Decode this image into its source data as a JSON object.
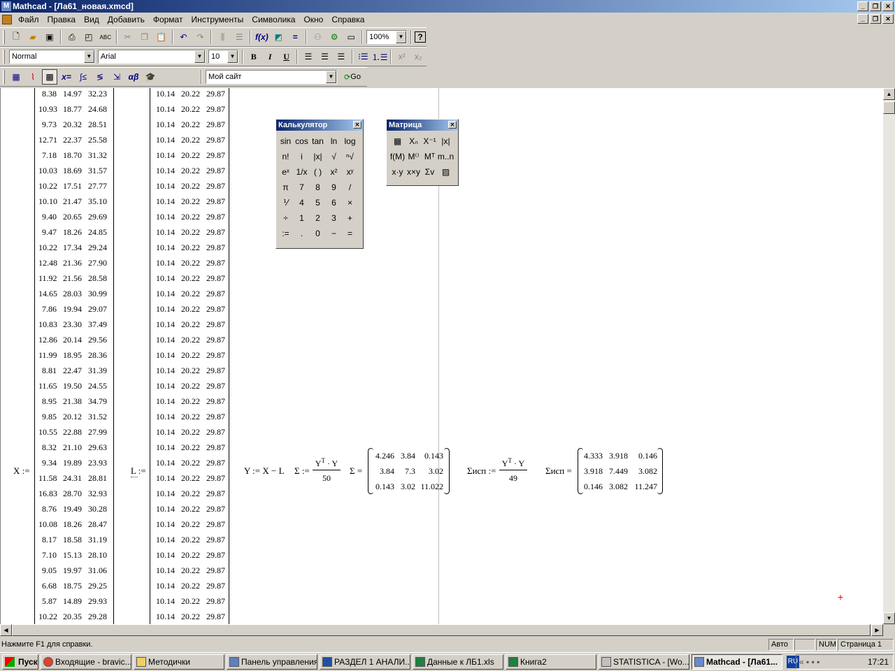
{
  "window": {
    "title": "Mathcad - [Ла61_новая.xmcd]"
  },
  "menu": [
    "Файл",
    "Правка",
    "Вид",
    "Добавить",
    "Формат",
    "Инструменты",
    "Символика",
    "Окно",
    "Справка"
  ],
  "toolbar": {
    "zoom": "100%"
  },
  "format": {
    "style": "Normal",
    "font": "Arial",
    "size": "10",
    "bold": "B",
    "italic": "I",
    "underline": "U"
  },
  "math_toolbar": {
    "address": "Мой сайт",
    "go": "Go"
  },
  "worksheet": {
    "x_label": "X :=",
    "l_label": "L :=",
    "X": [
      [
        "8.38",
        "14.97",
        "32.23"
      ],
      [
        "10.93",
        "18.77",
        "24.68"
      ],
      [
        "9.73",
        "20.32",
        "28.51"
      ],
      [
        "12.71",
        "22.37",
        "25.58"
      ],
      [
        "7.18",
        "18.70",
        "31.32"
      ],
      [
        "10.03",
        "18.69",
        "31.57"
      ],
      [
        "10.22",
        "17.51",
        "27.77"
      ],
      [
        "10.10",
        "21.47",
        "35.10"
      ],
      [
        "9.40",
        "20.65",
        "29.69"
      ],
      [
        "9.47",
        "18.26",
        "24.85"
      ],
      [
        "10.22",
        "17.34",
        "29.24"
      ],
      [
        "12.48",
        "21.36",
        "27.90"
      ],
      [
        "11.92",
        "21.56",
        "28.58"
      ],
      [
        "14.65",
        "28.03",
        "30.99"
      ],
      [
        "7.86",
        "19.94",
        "29.07"
      ],
      [
        "10.83",
        "23.30",
        "37.49"
      ],
      [
        "12.86",
        "20.14",
        "29.56"
      ],
      [
        "11.99",
        "18.95",
        "28.36"
      ],
      [
        "8.81",
        "22.47",
        "31.39"
      ],
      [
        "11.65",
        "19.50",
        "24.55"
      ],
      [
        "8.95",
        "21.38",
        "34.79"
      ],
      [
        "9.85",
        "20.12",
        "31.52"
      ],
      [
        "10.55",
        "22.88",
        "27.99"
      ],
      [
        "8.32",
        "21.10",
        "29.63"
      ],
      [
        "9.34",
        "19.89",
        "23.93"
      ],
      [
        "11.58",
        "24.31",
        "28.81"
      ],
      [
        "16.83",
        "28.70",
        "32.93"
      ],
      [
        "8.76",
        "19.49",
        "30.28"
      ],
      [
        "10.08",
        "18.26",
        "28.47"
      ],
      [
        "8.17",
        "18.58",
        "31.19"
      ],
      [
        "7.10",
        "15.13",
        "28.10"
      ],
      [
        "9.05",
        "19.97",
        "31.06"
      ],
      [
        "6.68",
        "18.75",
        "29.25"
      ],
      [
        "5.87",
        "14.89",
        "29.93"
      ],
      [
        "10.22",
        "20.35",
        "29.28"
      ]
    ],
    "L_row": [
      "10.14",
      "20.22",
      "29.87"
    ],
    "L_count": 35,
    "y_def": "Y := X − L",
    "sigma_def": "Σ :=",
    "sigma_eq": "Σ =",
    "sigma_isp_def": "Σисп :=",
    "sigma_isp_eq": "Σисп =",
    "numerator": "Y",
    "numerator_sup": "T",
    "numerator_rest": " · Y",
    "den50": "50",
    "den49": "49",
    "Sigma": [
      [
        "4.246",
        "3.84",
        "0.143"
      ],
      [
        "3.84",
        "7.3",
        "3.02"
      ],
      [
        "0.143",
        "3.02",
        "11.022"
      ]
    ],
    "SigmaIsp": [
      [
        "4.333",
        "3.918",
        "0.146"
      ],
      [
        "3.918",
        "7.449",
        "3.082"
      ],
      [
        "0.146",
        "3.082",
        "11.247"
      ]
    ]
  },
  "calculator": {
    "title": "Калькулятор",
    "keys": [
      "sin",
      "cos",
      "tan",
      "ln",
      "log",
      "n!",
      "i",
      "|x|",
      "√",
      "ⁿ√",
      "eˣ",
      "1/x",
      "( )",
      "x²",
      "xʸ",
      "π",
      "7",
      "8",
      "9",
      "/",
      "⅟",
      "4",
      "5",
      "6",
      "×",
      "÷",
      "1",
      "2",
      "3",
      "+",
      ":=",
      ".",
      "0",
      "−",
      "="
    ]
  },
  "matrix": {
    "title": "Матрица",
    "keys": [
      "▦",
      "Xₙ",
      "X⁻¹",
      "|x|",
      "f(M)",
      "M⁽⁾",
      "Mᵀ",
      "m..n",
      "x·y",
      "x×y",
      "Σv",
      "▨"
    ]
  },
  "status": {
    "help": "Нажмите F1 для справки.",
    "auto": "Авто",
    "num": "NUM",
    "page": "Страница 1"
  },
  "taskbar": {
    "start": "Пуск",
    "items": [
      "Входящие - bravic...",
      "Методички",
      "Панель управления",
      "РАЗДЕЛ 1 АНАЛИ...",
      "Данные к ЛБ1.xls",
      "Книга2",
      "STATISTICA - [Wo...",
      "Mathcad - [Ла61..."
    ],
    "lang": "RU",
    "clock": "17:21"
  }
}
